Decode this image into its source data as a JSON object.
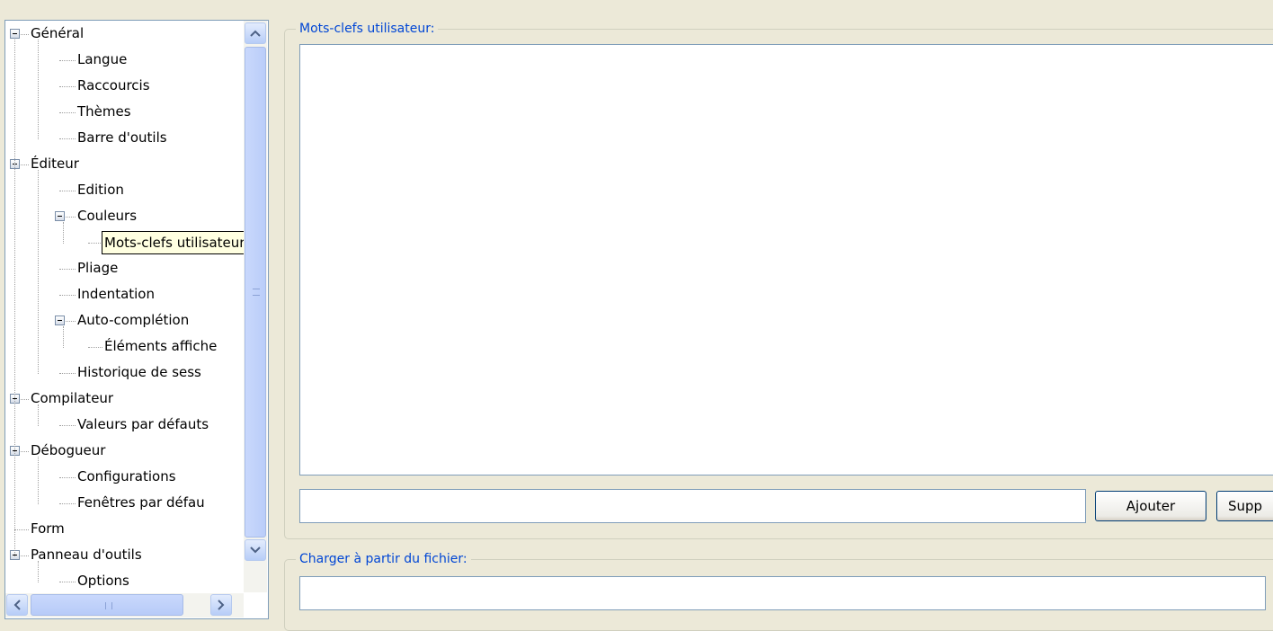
{
  "tree": {
    "items": [
      {
        "label": "Général",
        "level": 0,
        "expandable": true
      },
      {
        "label": "Langue",
        "level": 1,
        "expandable": false
      },
      {
        "label": "Raccourcis",
        "level": 1,
        "expandable": false
      },
      {
        "label": "Thèmes",
        "level": 1,
        "expandable": false
      },
      {
        "label": "Barre d'outils",
        "level": 1,
        "expandable": false
      },
      {
        "label": "Éditeur",
        "level": 0,
        "expandable": true
      },
      {
        "label": "Edition",
        "level": 1,
        "expandable": false
      },
      {
        "label": "Couleurs",
        "level": 1,
        "expandable": true
      },
      {
        "label": "Mots-clefs utilisateur",
        "level": 2,
        "expandable": false,
        "selected": true
      },
      {
        "label": "Pliage",
        "level": 1,
        "expandable": false
      },
      {
        "label": "Indentation",
        "level": 1,
        "expandable": false
      },
      {
        "label": "Auto-complétion",
        "level": 1,
        "expandable": true
      },
      {
        "label": "Éléments affiche",
        "level": 2,
        "expandable": false
      },
      {
        "label": "Historique de sess",
        "level": 1,
        "expandable": false
      },
      {
        "label": "Compilateur",
        "level": 0,
        "expandable": true
      },
      {
        "label": "Valeurs par défauts",
        "level": 1,
        "expandable": false
      },
      {
        "label": "Débogueur",
        "level": 0,
        "expandable": true
      },
      {
        "label": "Configurations",
        "level": 1,
        "expandable": false
      },
      {
        "label": "Fenêtres par défau",
        "level": 1,
        "expandable": false
      },
      {
        "label": "Form",
        "level": 0,
        "expandable": false
      },
      {
        "label": "Panneau d'outils",
        "level": 0,
        "expandable": true
      },
      {
        "label": "Options",
        "level": 1,
        "expandable": false
      }
    ],
    "scroll_up_icon": "chevron-up-icon",
    "scroll_down_icon": "chevron-down-icon",
    "scroll_left_icon": "chevron-left-icon",
    "scroll_right_icon": "chevron-right-icon"
  },
  "keywords_group": {
    "title": "Mots-clefs utilisateur:",
    "keywords": [],
    "input_value": "",
    "add_button": "Ajouter",
    "remove_button": "Supp"
  },
  "file_group": {
    "title": "Charger à partir du fichier:",
    "file_value": ""
  },
  "colors": {
    "background": "#ece9d8",
    "group_title": "#0046d5",
    "input_border": "#7f9db9",
    "selection_bg": "#ffffe1"
  }
}
